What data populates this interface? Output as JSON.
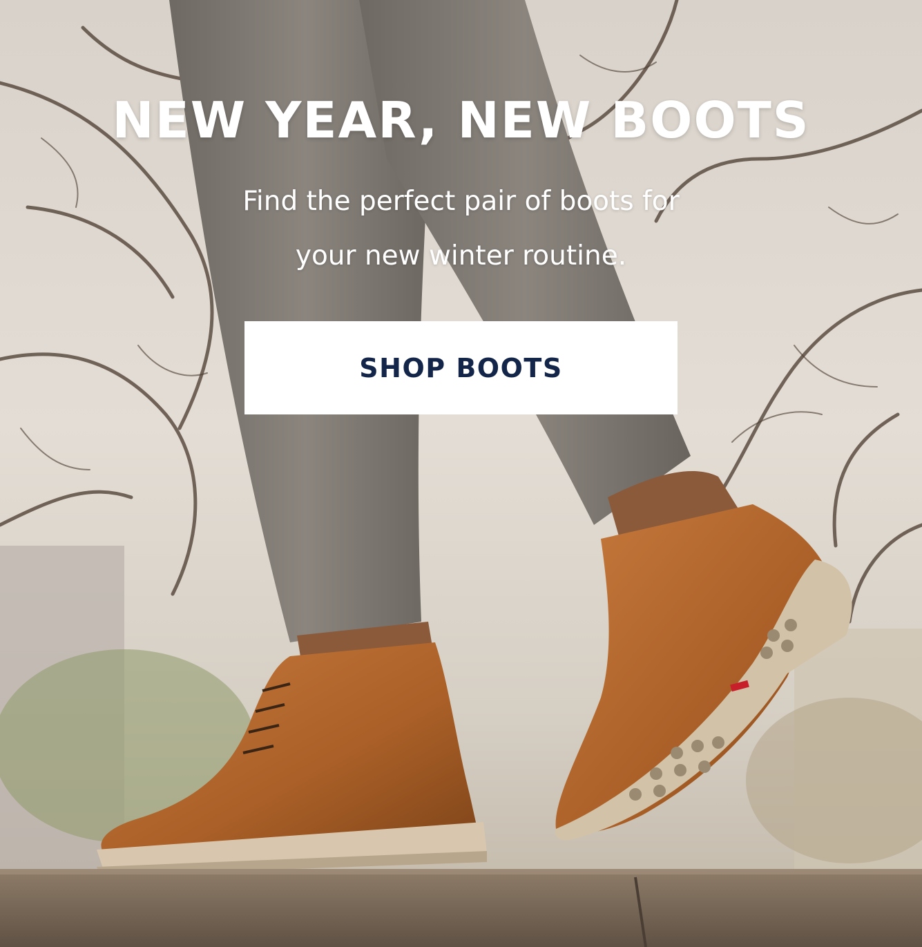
{
  "hero": {
    "title": "NEW YEAR, NEW BOOTS",
    "subtitle_line1": "Find the perfect pair of boots for",
    "subtitle_line2": "your new winter routine.",
    "cta_label": "SHOP BOOTS",
    "image": "man walking on stone ledge wearing tan leather chukka boots and grey trousers, bare winter tree branches behind"
  },
  "colors": {
    "headline_text": "#ffffff",
    "cta_background": "#ffffff",
    "cta_text": "#14254a",
    "boot_leather": "#b0652e"
  }
}
